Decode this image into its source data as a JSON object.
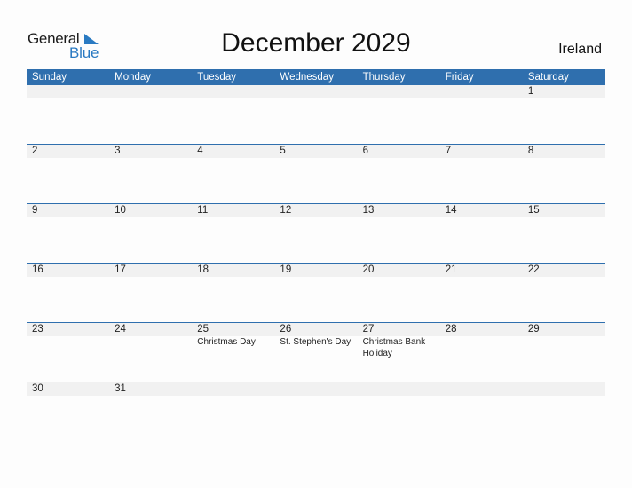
{
  "logo": {
    "line1": "General",
    "line2": "Blue"
  },
  "title": "December 2029",
  "country": "Ireland",
  "colors": {
    "accent": "#2f6fae",
    "logo_blue": "#2a7ac2",
    "date_row_bg": "#f1f1f1"
  },
  "weekdays": [
    "Sunday",
    "Monday",
    "Tuesday",
    "Wednesday",
    "Thursday",
    "Friday",
    "Saturday"
  ],
  "weeks": [
    {
      "days": [
        "",
        "",
        "",
        "",
        "",
        "",
        "1"
      ],
      "events": [
        "",
        "",
        "",
        "",
        "",
        "",
        ""
      ]
    },
    {
      "days": [
        "2",
        "3",
        "4",
        "5",
        "6",
        "7",
        "8"
      ],
      "events": [
        "",
        "",
        "",
        "",
        "",
        "",
        ""
      ]
    },
    {
      "days": [
        "9",
        "10",
        "11",
        "12",
        "13",
        "14",
        "15"
      ],
      "events": [
        "",
        "",
        "",
        "",
        "",
        "",
        ""
      ]
    },
    {
      "days": [
        "16",
        "17",
        "18",
        "19",
        "20",
        "21",
        "22"
      ],
      "events": [
        "",
        "",
        "",
        "",
        "",
        "",
        ""
      ]
    },
    {
      "days": [
        "23",
        "24",
        "25",
        "26",
        "27",
        "28",
        "29"
      ],
      "events": [
        "",
        "",
        "Christmas Day",
        "St. Stephen's Day",
        "Christmas Bank Holiday",
        "",
        ""
      ]
    },
    {
      "days": [
        "30",
        "31",
        "",
        "",
        "",
        "",
        ""
      ],
      "events": [
        "",
        "",
        "",
        "",
        "",
        "",
        ""
      ]
    }
  ]
}
